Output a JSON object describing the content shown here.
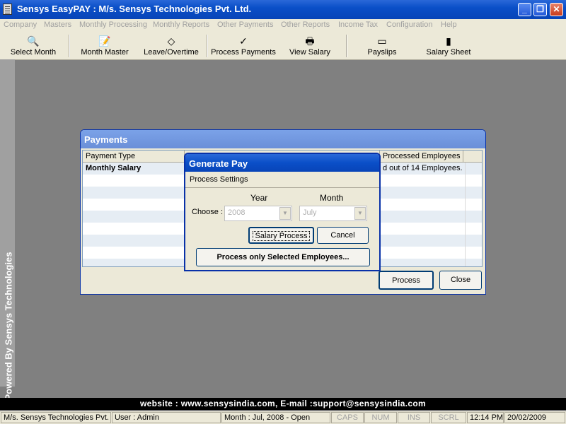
{
  "window": {
    "title": "Sensys EasyPAY : M/s. Sensys Technologies Pvt. Ltd.",
    "minimize_glyph": "_",
    "restore_glyph": "❐",
    "close_glyph": "✕"
  },
  "menu": [
    "Company",
    "Masters",
    "Monthly Processing",
    "Monthly Reports",
    "Other Payments",
    "Other Reports",
    "Income Tax",
    "Configuration",
    "Help"
  ],
  "toolbar": [
    {
      "label": "Select Month",
      "icon": "select-month-icon",
      "glyph": "🔍"
    },
    {
      "label": "Month Master",
      "icon": "month-master-icon",
      "glyph": "📝"
    },
    {
      "label": "Leave/Overtime",
      "icon": "leave-overtime-icon",
      "glyph": "◇"
    },
    {
      "label": "Process Payments",
      "icon": "checkmark-icon",
      "glyph": "✓"
    },
    {
      "label": "View Salary",
      "icon": "view-salary-icon",
      "glyph": "🖶"
    },
    {
      "label": "Payslips",
      "icon": "payslips-icon",
      "glyph": "▭"
    },
    {
      "label": "Salary Sheet",
      "icon": "salary-sheet-icon",
      "glyph": "▮"
    }
  ],
  "side_text": "Powered By Sensys Technologies",
  "payments": {
    "title": "Payments",
    "columns": [
      "Payment Type",
      "Processed Employees"
    ],
    "rows": [
      {
        "type": "Monthly Salary",
        "processed": "d out of 14 Employees."
      }
    ],
    "process_label": "Process",
    "close_label": "Close"
  },
  "generate_pay": {
    "title": "Generate Pay",
    "section_label": "Process Settings",
    "year_label": "Year",
    "month_label": "Month",
    "choose_label": "Choose :",
    "year_value": "2008",
    "month_value": "July",
    "salary_process_label": "Salary Process",
    "cancel_label": "Cancel",
    "selected_label": "Process only Selected Employees..."
  },
  "footer": {
    "website": "website : www.sensysindia.com, E-mail :support@sensysindia.com"
  },
  "status": {
    "company": "M/s. Sensys Technologies Pvt.",
    "user": "User : Admin",
    "month": "Month : Jul, 2008 - Open",
    "caps": "CAPS",
    "num": "NUM",
    "ins": "INS",
    "scrl": "SCRL",
    "time": "12:14 PM",
    "date": "20/02/2009"
  },
  "colors": {
    "titlebar": "#0a4fc8",
    "desktop": "#808080",
    "panel": "#ece9d8"
  }
}
